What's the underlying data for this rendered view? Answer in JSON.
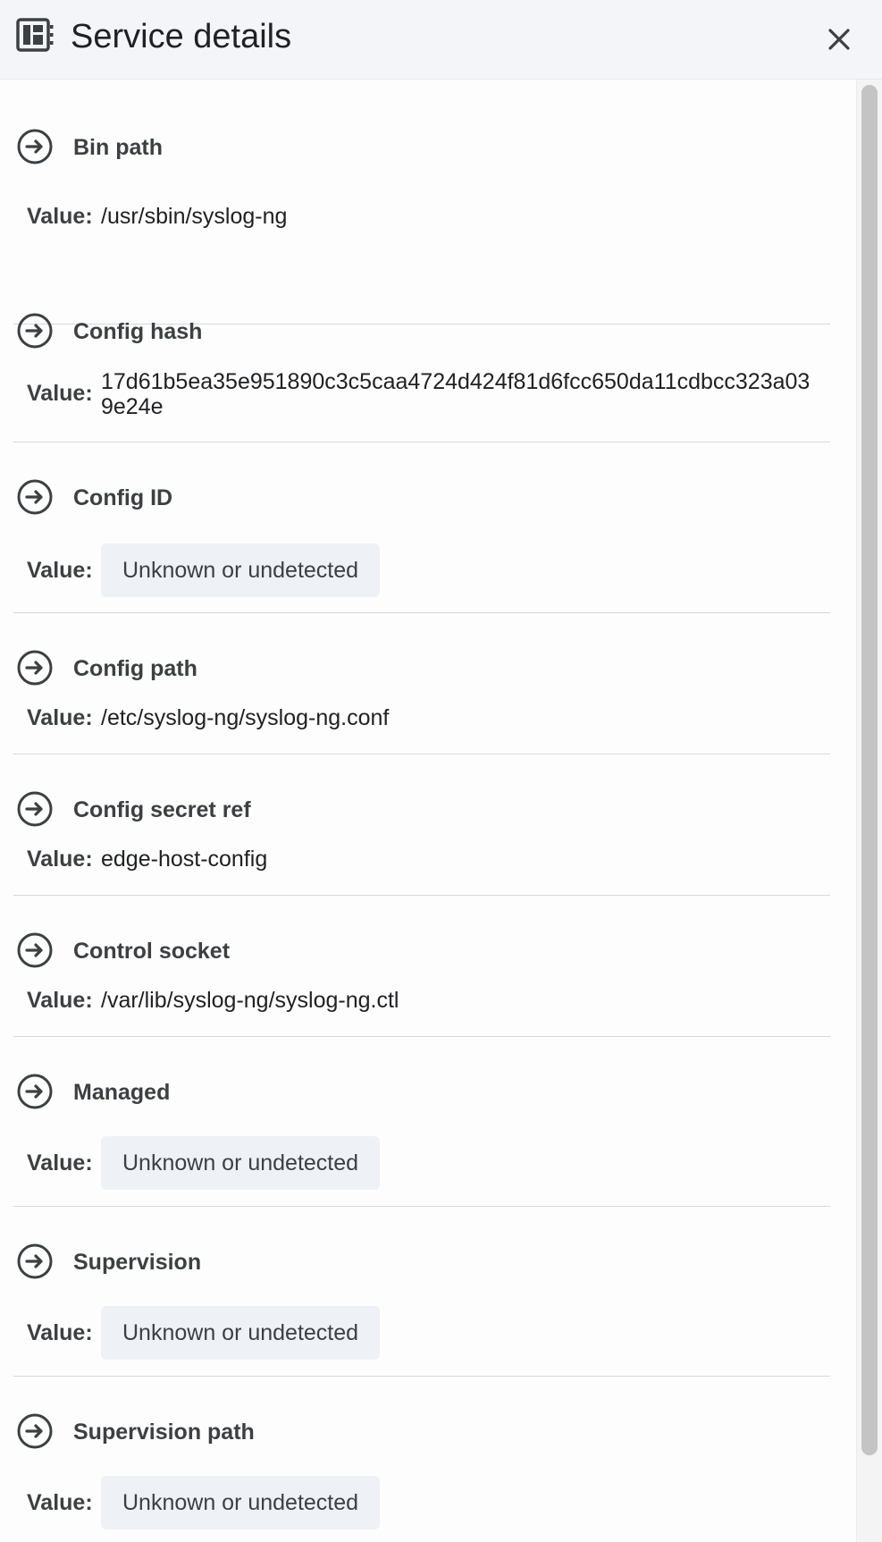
{
  "header": {
    "title": "Service details",
    "icon": "service-details-icon",
    "close_icon": "close-icon"
  },
  "value_label": "Value:",
  "items": [
    {
      "label": "Bin path",
      "value": "/usr/sbin/syslog-ng",
      "value_type": "text"
    },
    {
      "label": "Config hash",
      "value": "17d61b5ea35e951890c3c5caa4724d424f81d6fcc650da11cdbcc323a039e24e",
      "value_type": "multiline"
    },
    {
      "label": "Config ID",
      "value": "Unknown or undetected",
      "value_type": "chip"
    },
    {
      "label": "Config path",
      "value": "/etc/syslog-ng/syslog-ng.conf",
      "value_type": "text"
    },
    {
      "label": "Config secret ref",
      "value": "edge-host-config",
      "value_type": "text"
    },
    {
      "label": "Control socket",
      "value": "/var/lib/syslog-ng/syslog-ng.ctl",
      "value_type": "text"
    },
    {
      "label": "Managed",
      "value": "Unknown or undetected",
      "value_type": "chip"
    },
    {
      "label": "Supervision",
      "value": "Unknown or undetected",
      "value_type": "chip"
    },
    {
      "label": "Supervision path",
      "value": "Unknown or undetected",
      "value_type": "chip"
    }
  ],
  "colors": {
    "header_bg": "#f3f5f9",
    "chip_bg": "#eef1f6",
    "divider": "#d6d8db",
    "text": "#202124"
  }
}
